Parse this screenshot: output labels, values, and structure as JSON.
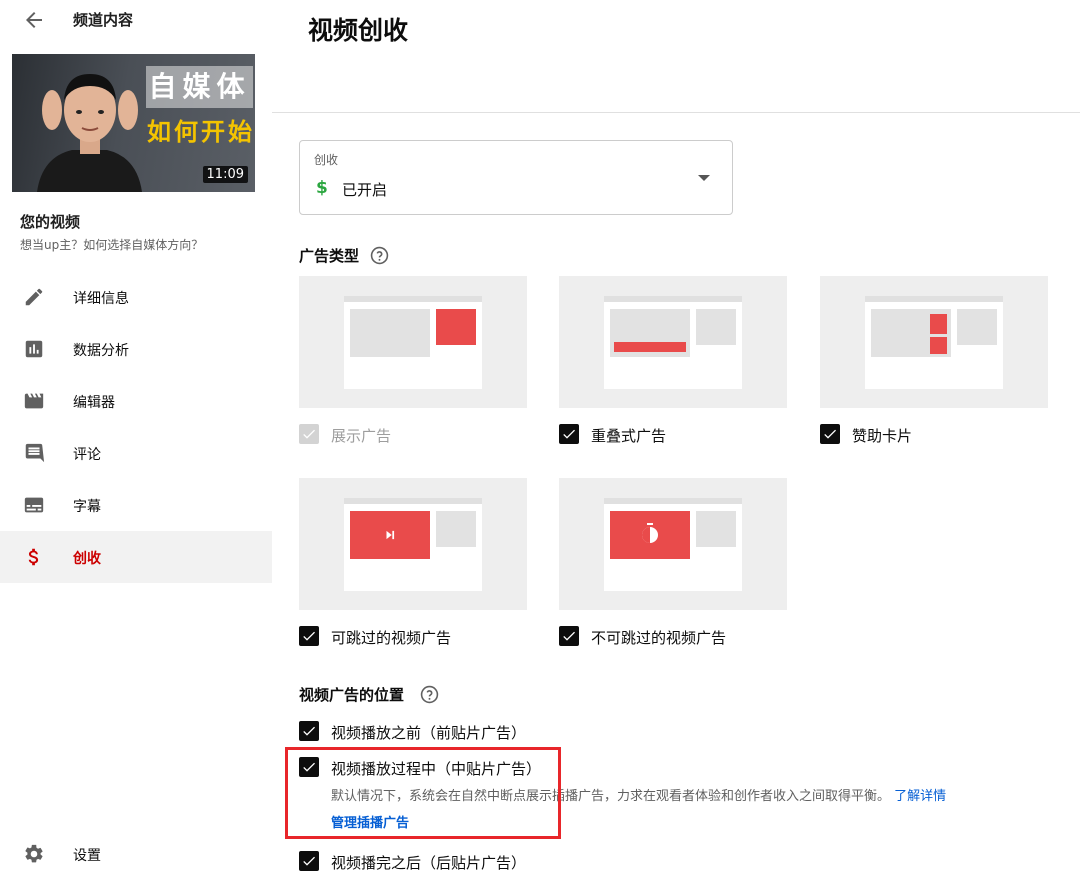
{
  "sidebar": {
    "title": "频道内容",
    "back_icon": "arrow-back-icon",
    "thumbnail": {
      "overlay_text_1": "自媒体",
      "overlay_text_2": "如何开始",
      "duration": "11:09"
    },
    "your_video": "您的视频",
    "video_title": "想当up主？如何选择自媒体方向？",
    "items": [
      {
        "label": "详细信息",
        "icon": "pencil-icon"
      },
      {
        "label": "数据分析",
        "icon": "analytics-icon"
      },
      {
        "label": "编辑器",
        "icon": "clapperboard-icon"
      },
      {
        "label": "评论",
        "icon": "comment-icon"
      },
      {
        "label": "字幕",
        "icon": "subtitles-icon"
      },
      {
        "label": "创收",
        "icon": "dollar-icon",
        "active": true
      }
    ],
    "settings": {
      "label": "设置",
      "icon": "gear-icon"
    }
  },
  "main": {
    "title": "视频创收",
    "monetization_select": {
      "label": "创收",
      "value": "已开启",
      "value_icon": "$"
    },
    "ad_types": {
      "title": "广告类型",
      "options": [
        {
          "label": "展示广告",
          "checked": true,
          "disabled": true
        },
        {
          "label": "重叠式广告",
          "checked": true
        },
        {
          "label": "赞助卡片",
          "checked": true
        },
        {
          "label": "可跳过的视频广告",
          "checked": true
        },
        {
          "label": "不可跳过的视频广告",
          "checked": true
        }
      ]
    },
    "ad_positions": {
      "title": "视频广告的位置",
      "options": [
        {
          "label": "视频播放之前（前贴片广告）",
          "checked": true
        },
        {
          "label": "视频播放过程中（中贴片广告）",
          "checked": true
        },
        {
          "label": "视频播完之后（后贴片广告）",
          "checked": true
        }
      ],
      "midroll_description": "默认情况下，系统会在自然中断点展示插播广告，力求在观看者体验和创作者收入之间取得平衡。",
      "learn_more": "了解详情",
      "manage_link": "管理插播广告"
    }
  },
  "colors": {
    "accent_red": "#cc0000",
    "link_blue": "#065fd4",
    "ad_red": "#e94b4b",
    "highlight": "#e8262a",
    "dollar_green": "#2ba640"
  }
}
